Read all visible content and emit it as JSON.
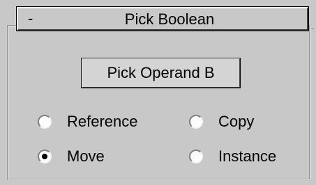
{
  "rollout": {
    "collapse_sign": "-",
    "title": "Pick Boolean"
  },
  "pick_button": {
    "label": "Pick Operand B"
  },
  "operand_options": [
    {
      "label": "Reference",
      "checked": false
    },
    {
      "label": "Copy",
      "checked": false
    },
    {
      "label": "Move",
      "checked": true
    },
    {
      "label": "Instance",
      "checked": false
    }
  ],
  "colors": {
    "panel_bg": "#c8c8c8",
    "highlight": "#f4f4f4",
    "shadow": "#404040",
    "text": "#000000"
  }
}
